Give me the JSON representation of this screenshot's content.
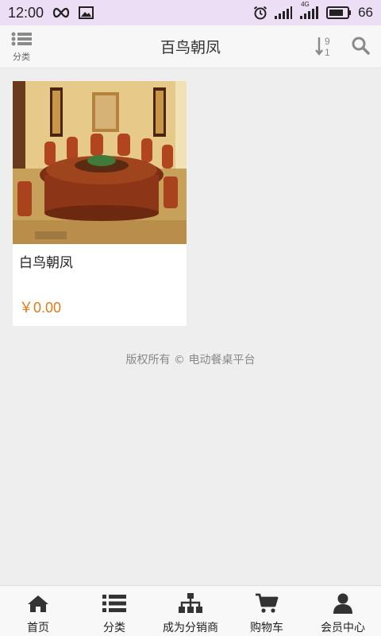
{
  "status_bar": {
    "time": "12:00",
    "battery": "66",
    "network": "4G"
  },
  "header": {
    "category_label": "分类",
    "title": "百鸟朝凤",
    "sort_digit_top": "9",
    "sort_digit_bottom": "1"
  },
  "products": [
    {
      "name": "白鸟朝凤",
      "price": "￥0.00"
    }
  ],
  "footer": {
    "copyright": "版权所有 © 电动餐桌平台"
  },
  "bottom_nav": [
    {
      "label": "首页",
      "icon": "home-icon"
    },
    {
      "label": "分类",
      "icon": "list-icon"
    },
    {
      "label": "成为分销商",
      "icon": "sitemap-icon"
    },
    {
      "label": "购物车",
      "icon": "cart-icon"
    },
    {
      "label": "会员中心",
      "icon": "user-icon"
    }
  ],
  "colors": {
    "price": "#e07a17",
    "status_bar_bg": "#ecdff5",
    "icon_gray": "#8a8a8a"
  }
}
